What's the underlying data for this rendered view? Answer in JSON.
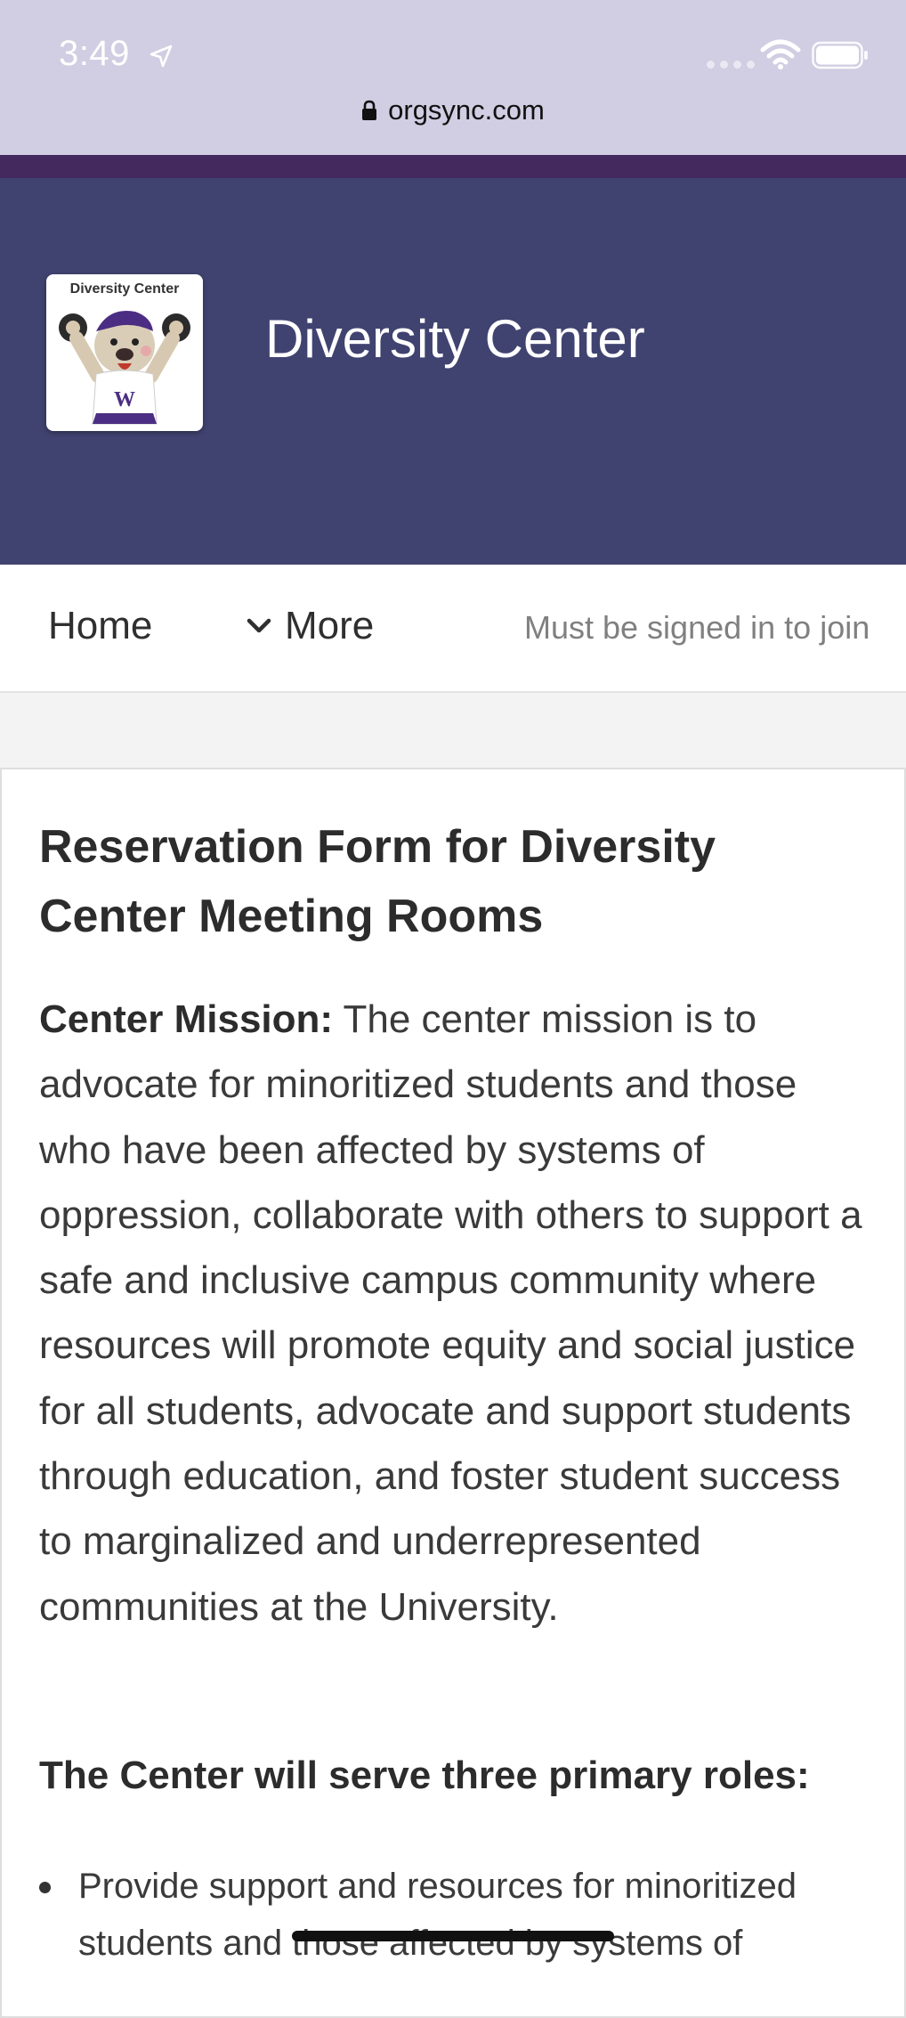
{
  "status_bar": {
    "time": "3:49",
    "url": "orgsync.com"
  },
  "header": {
    "org_name": "Diversity Center",
    "logo_text": "Diversity Center",
    "logo_letter": "W",
    "colors": {
      "header_bg": "#404370",
      "stripe": "#43295e",
      "status_bg": "#d1cde2"
    }
  },
  "nav": {
    "home_label": "Home",
    "more_label": "More",
    "join_notice": "Must be signed in to join"
  },
  "content": {
    "title": "Reservation Form for Diversity Center Meeting Rooms",
    "mission_label": "Center Mission:",
    "mission_text": " The center mission is to advocate for minoritized students and those who have been affected by systems of oppression, collaborate with others to support a safe and inclusive campus community where resources will promote equity and social justice for all students, advocate and support students through education, and foster student success to marginalized and underrepresented communities at the University.",
    "roles_heading": "The Center will serve three primary roles:",
    "roles": [
      "Provide support and resources for minoritized students and those affected by systems of"
    ]
  },
  "icons": {
    "location": "location-arrow-icon",
    "wifi": "wifi-icon",
    "battery": "battery-icon",
    "lock": "lock-icon",
    "chevron": "chevron-down-icon"
  }
}
